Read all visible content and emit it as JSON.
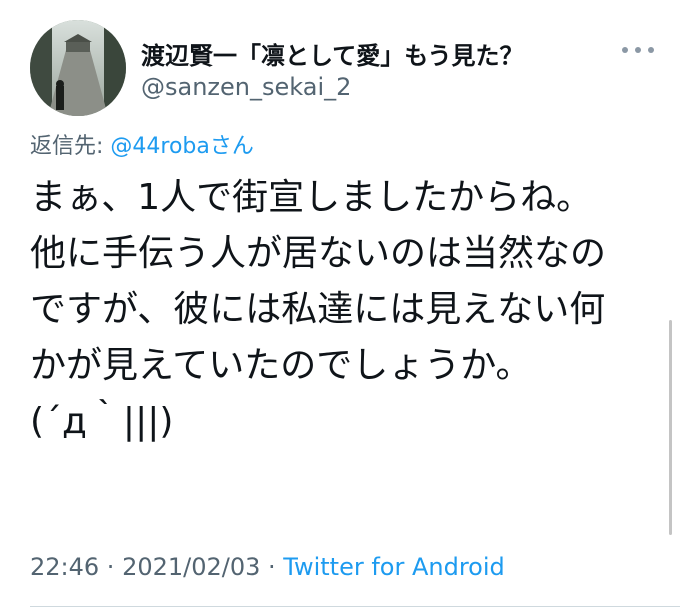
{
  "user": {
    "display_name": "渡辺賢一「凛として愛」もう見た？",
    "handle": "@sanzen_sekai_2"
  },
  "reply": {
    "prefix": "返信先: ",
    "mention": "@44robaさん"
  },
  "tweet": {
    "text": "まぁ、1人で街宣しましたからね。\n他に手伝う人が居ないのは当然なのですが、彼には私達には見えない何かが見えていたのでしょうか。\n(´д｀|||)",
    "time": "22:46",
    "separator_1": " · ",
    "date": "2021/02/03",
    "separator_2": " · ",
    "source": "Twitter for Android"
  },
  "icons": {
    "more": "more-horizontal-icon",
    "avatar": "avatar-photo"
  },
  "colors": {
    "accent": "#1d9bf0",
    "muted": "#536471",
    "text": "#0f1419"
  }
}
